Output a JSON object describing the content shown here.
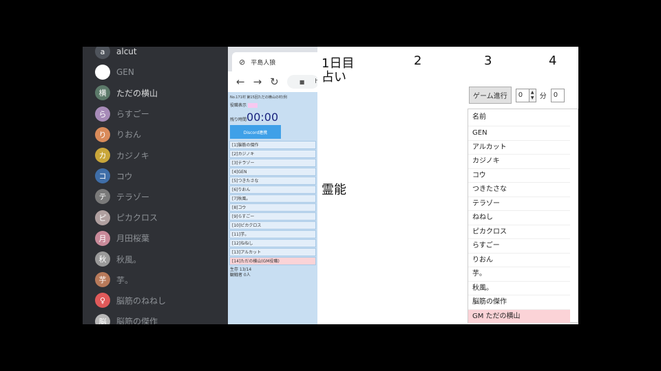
{
  "members": [
    {
      "name": "alcut",
      "color": "#4f545c",
      "initial": "a",
      "bright": true
    },
    {
      "name": "GEN",
      "color": "#ffffff",
      "initial": "",
      "bright": false
    },
    {
      "name": "ただの横山",
      "color": "#5c7a6a",
      "initial": "横",
      "bright": true
    },
    {
      "name": "らすごー",
      "color": "#a78bb8",
      "initial": "ら",
      "bright": false
    },
    {
      "name": "りおん",
      "color": "#d98b5a",
      "initial": "り",
      "bright": false
    },
    {
      "name": "カジノキ",
      "color": "#c9a63a",
      "initial": "カ",
      "bright": false
    },
    {
      "name": "コウ",
      "color": "#3f6ea8",
      "initial": "コ",
      "bright": false
    },
    {
      "name": "テラゾー",
      "color": "#7a7a7a",
      "initial": "テ",
      "bright": false
    },
    {
      "name": "ピカクロス",
      "color": "#b0a0a0",
      "initial": "ピ",
      "bright": false
    },
    {
      "name": "月田桜葉",
      "color": "#c98a9a",
      "initial": "月",
      "bright": false
    },
    {
      "name": "秋風。",
      "color": "#9a9a9a",
      "initial": "秋",
      "bright": false
    },
    {
      "name": "芋。",
      "color": "#b87a5a",
      "initial": "芋",
      "bright": false
    },
    {
      "name": "脳筋のねねし",
      "color": "#e05a5a",
      "initial": "♀",
      "bright": false
    },
    {
      "name": "脳筋の傑作",
      "color": "#b8b8b8",
      "initial": "脳",
      "bright": false
    }
  ],
  "browser": {
    "tab_title": "平島人狼",
    "address": "h"
  },
  "game": {
    "info": "No.171村 第15回ただの横山の村(例",
    "role_label": "役職表示",
    "time_label": "残り時間",
    "timer": "00:00",
    "start_button": "Discord連携",
    "players": [
      "[1]脳筋の傑作",
      "[2]カジノキ",
      "[3]テラゾー",
      "[4]GEN",
      "[5]つきたさな",
      "[6]りおん",
      "[7]秋風。",
      "[8]コウ",
      "[9]らすごー",
      "[10]ピカクロス",
      "[11]芋。",
      "[12]ねねし",
      "[13]アルカット",
      "[14]ただの横山(GM役職)"
    ],
    "footer_line1": "生存 13/14",
    "footer_line2": "観戦者 0人"
  },
  "board": {
    "day_headers": [
      "1日目",
      "2",
      "3",
      "4"
    ],
    "fortune_label": "占い",
    "medium_label": "霊能",
    "proceed_button": "ゲーム進行",
    "minute_value": "0",
    "minute_label": "分",
    "second_value": "0",
    "names_header": "名前",
    "names": [
      "GEN",
      "アルカット",
      "カジノキ",
      "コウ",
      "つきたさな",
      "テラゾー",
      "ねねし",
      "ピカクロス",
      "らすごー",
      "りおん",
      "芋。",
      "秋風。",
      "脳筋の傑作"
    ],
    "gm_row": "GM ただの横山"
  }
}
